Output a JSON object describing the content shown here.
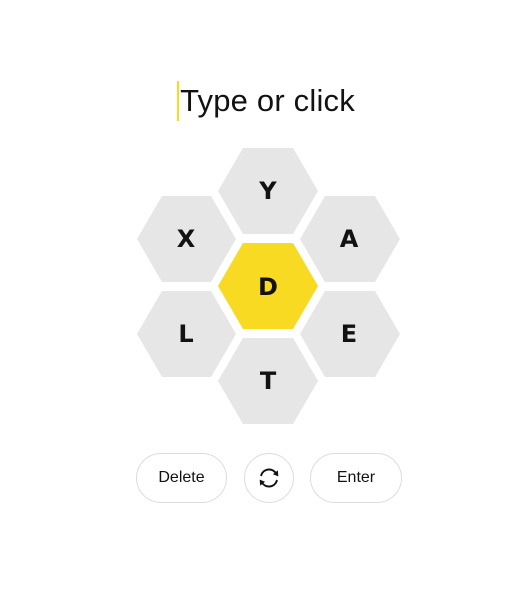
{
  "input": {
    "placeholder": "Type or click"
  },
  "hive": {
    "center_letter": "D",
    "outer_letters": {
      "top": "Y",
      "upper_left": "X",
      "upper_right": "A",
      "lower_left": "L",
      "lower_right": "E",
      "bottom": "T"
    }
  },
  "controls": {
    "delete_label": "Delete",
    "shuffle_icon": "shuffle-icon",
    "enter_label": "Enter"
  },
  "colors": {
    "center_cell": "#f7da21",
    "outer_cell": "#e6e6e6",
    "caret": "#f7da21",
    "text": "#121212"
  }
}
